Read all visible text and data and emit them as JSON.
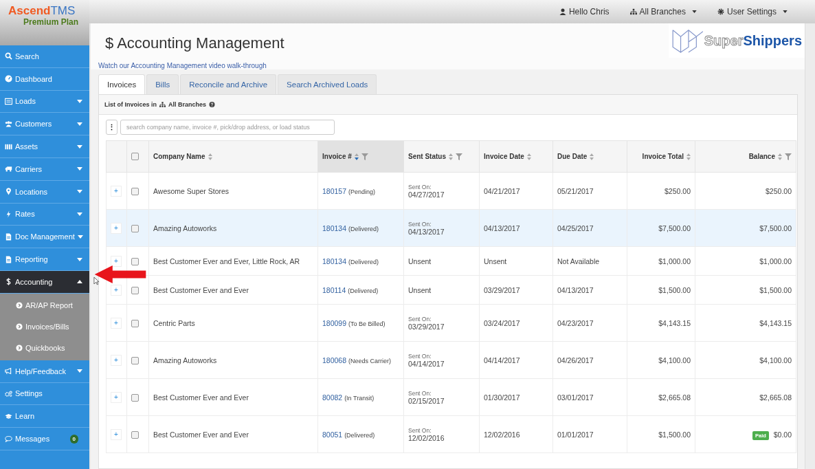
{
  "brand": {
    "name_a": "Ascend",
    "name_b": "TMS",
    "plan": "Premium Plan"
  },
  "topbar": {
    "user": "Hello Chris",
    "branches": "All Branches",
    "settings": "User Settings"
  },
  "partner_logo": {
    "name_a": "Super",
    "name_b": "Shippers"
  },
  "sidebar": {
    "items": [
      {
        "label": "Search",
        "selected": false
      },
      {
        "label": "Dashboard",
        "selected": false
      },
      {
        "label": "Loads",
        "expanded": false,
        "selected": false
      },
      {
        "label": "Customers",
        "expanded": false,
        "selected": false
      },
      {
        "label": "Assets",
        "expanded": false,
        "selected": false
      },
      {
        "label": "Carriers",
        "expanded": false,
        "selected": false
      },
      {
        "label": "Locations",
        "expanded": false,
        "selected": false
      },
      {
        "label": "Rates",
        "expanded": false,
        "selected": false
      },
      {
        "label": "Doc Management",
        "expanded": false,
        "selected": false
      },
      {
        "label": "Reporting",
        "expanded": false,
        "selected": false
      },
      {
        "label": "Accounting",
        "expanded": true,
        "selected": true,
        "children": [
          {
            "label": "AR/AP Report"
          },
          {
            "label": "Invoices/Bills"
          },
          {
            "label": "Quickbooks"
          }
        ]
      },
      {
        "label": "Help/Feedback",
        "expanded": false,
        "selected": false
      },
      {
        "label": "Settings",
        "selected": false
      },
      {
        "label": "Learn",
        "selected": false
      },
      {
        "label": "Messages",
        "selected": false,
        "badge": "0"
      }
    ]
  },
  "page": {
    "title": "Accounting Management",
    "title_icon": "$",
    "video_link": "Watch our Accounting Management video walk-through"
  },
  "tabs": [
    {
      "label": "Invoices",
      "selected": true
    },
    {
      "label": "Bills",
      "selected": false
    },
    {
      "label": "Reconcile and Archive",
      "selected": false
    },
    {
      "label": "Search Archived Loads",
      "selected": false
    }
  ],
  "list_heading": {
    "prefix": "List of Invoices in",
    "branch": "All Branches"
  },
  "search": {
    "menu_glyph": "⋮",
    "placeholder": "search company name, invoice #, pick/drop address, or load status"
  },
  "table": {
    "all_checked": false,
    "columns": [
      {
        "label": "Company Name",
        "filter": false,
        "sorted": false
      },
      {
        "label": "Invoice #",
        "filter": true,
        "sorted": true
      },
      {
        "label": "Sent Status",
        "filter": true,
        "sorted": false
      },
      {
        "label": "Invoice Date",
        "filter": false,
        "sorted": false
      },
      {
        "label": "Due Date",
        "filter": false,
        "sorted": false
      },
      {
        "label": "Invoice Total",
        "filter": false,
        "sorted": false
      },
      {
        "label": "Balance",
        "filter": true,
        "sorted": false
      }
    ],
    "rows": [
      {
        "expand_glyph": "+",
        "selected": false,
        "checked": false,
        "company": "Awesome Super Stores",
        "invoice": "180157",
        "load_status": "(Pending)",
        "sent_label": "Sent On:",
        "sent": "04/27/2017",
        "invoice_date": "04/21/2017",
        "due_date": "05/21/2017",
        "total": "$250.00",
        "balance": "$250.00"
      },
      {
        "expand_glyph": "+",
        "selected": true,
        "checked": false,
        "company": "Amazing Autoworks",
        "invoice": "180134",
        "load_status": "(Delivered)",
        "sent_label": "Sent On:",
        "sent": "04/13/2017",
        "invoice_date": "04/13/2017",
        "due_date": "04/25/2017",
        "total": "$7,500.00",
        "balance": "$7,500.00"
      },
      {
        "expand_glyph": "+",
        "selected": false,
        "checked": false,
        "company": "Best Customer Ever and Ever, Little Rock, AR",
        "invoice": "180134",
        "load_status": "(Delivered)",
        "sent": "Unsent",
        "invoice_date": "Unsent",
        "due_date": "Not Available",
        "total": "$1,000.00",
        "balance": "$1,000.00"
      },
      {
        "expand_glyph": "+",
        "selected": false,
        "checked": false,
        "company": "Best Customer Ever and Ever",
        "invoice": "180114",
        "load_status": "(Delivered)",
        "sent": "Unsent",
        "invoice_date": "03/29/2017",
        "due_date": "04/13/2017",
        "total": "$1,500.00",
        "balance": "$1,500.00"
      },
      {
        "expand_glyph": "+",
        "selected": false,
        "checked": false,
        "company": "Centric Parts",
        "invoice": "180099",
        "load_status": "(To Be Billed)",
        "sent_label": "Sent On:",
        "sent": "03/29/2017",
        "invoice_date": "03/24/2017",
        "due_date": "04/23/2017",
        "total": "$4,143.15",
        "balance": "$4,143.15"
      },
      {
        "expand_glyph": "+",
        "selected": false,
        "checked": false,
        "company": "Amazing Autoworks",
        "invoice": "180068",
        "load_status": "(Needs Carrier)",
        "sent_label": "Sent On:",
        "sent": "04/14/2017",
        "invoice_date": "04/14/2017",
        "due_date": "04/26/2017",
        "total": "$4,100.00",
        "balance": "$4,100.00"
      },
      {
        "expand_glyph": "+",
        "selected": false,
        "checked": false,
        "company": "Best Customer Ever and Ever",
        "invoice": "80082",
        "load_status": "(In Transit)",
        "sent_label": "Sent On:",
        "sent": "02/15/2017",
        "invoice_date": "01/30/2017",
        "due_date": "03/01/2017",
        "total": "$2,665.08",
        "balance": "$2,665.08"
      },
      {
        "expand_glyph": "+",
        "selected": false,
        "checked": false,
        "company": "Best Customer Ever and Ever",
        "invoice": "80051",
        "load_status": "(Delivered)",
        "sent_label": "Sent On:",
        "sent": "12/02/2016",
        "invoice_date": "12/02/2016",
        "due_date": "01/01/2017",
        "total": "$1,500.00",
        "balance": "$0.00",
        "badge": "Paid"
      }
    ]
  }
}
